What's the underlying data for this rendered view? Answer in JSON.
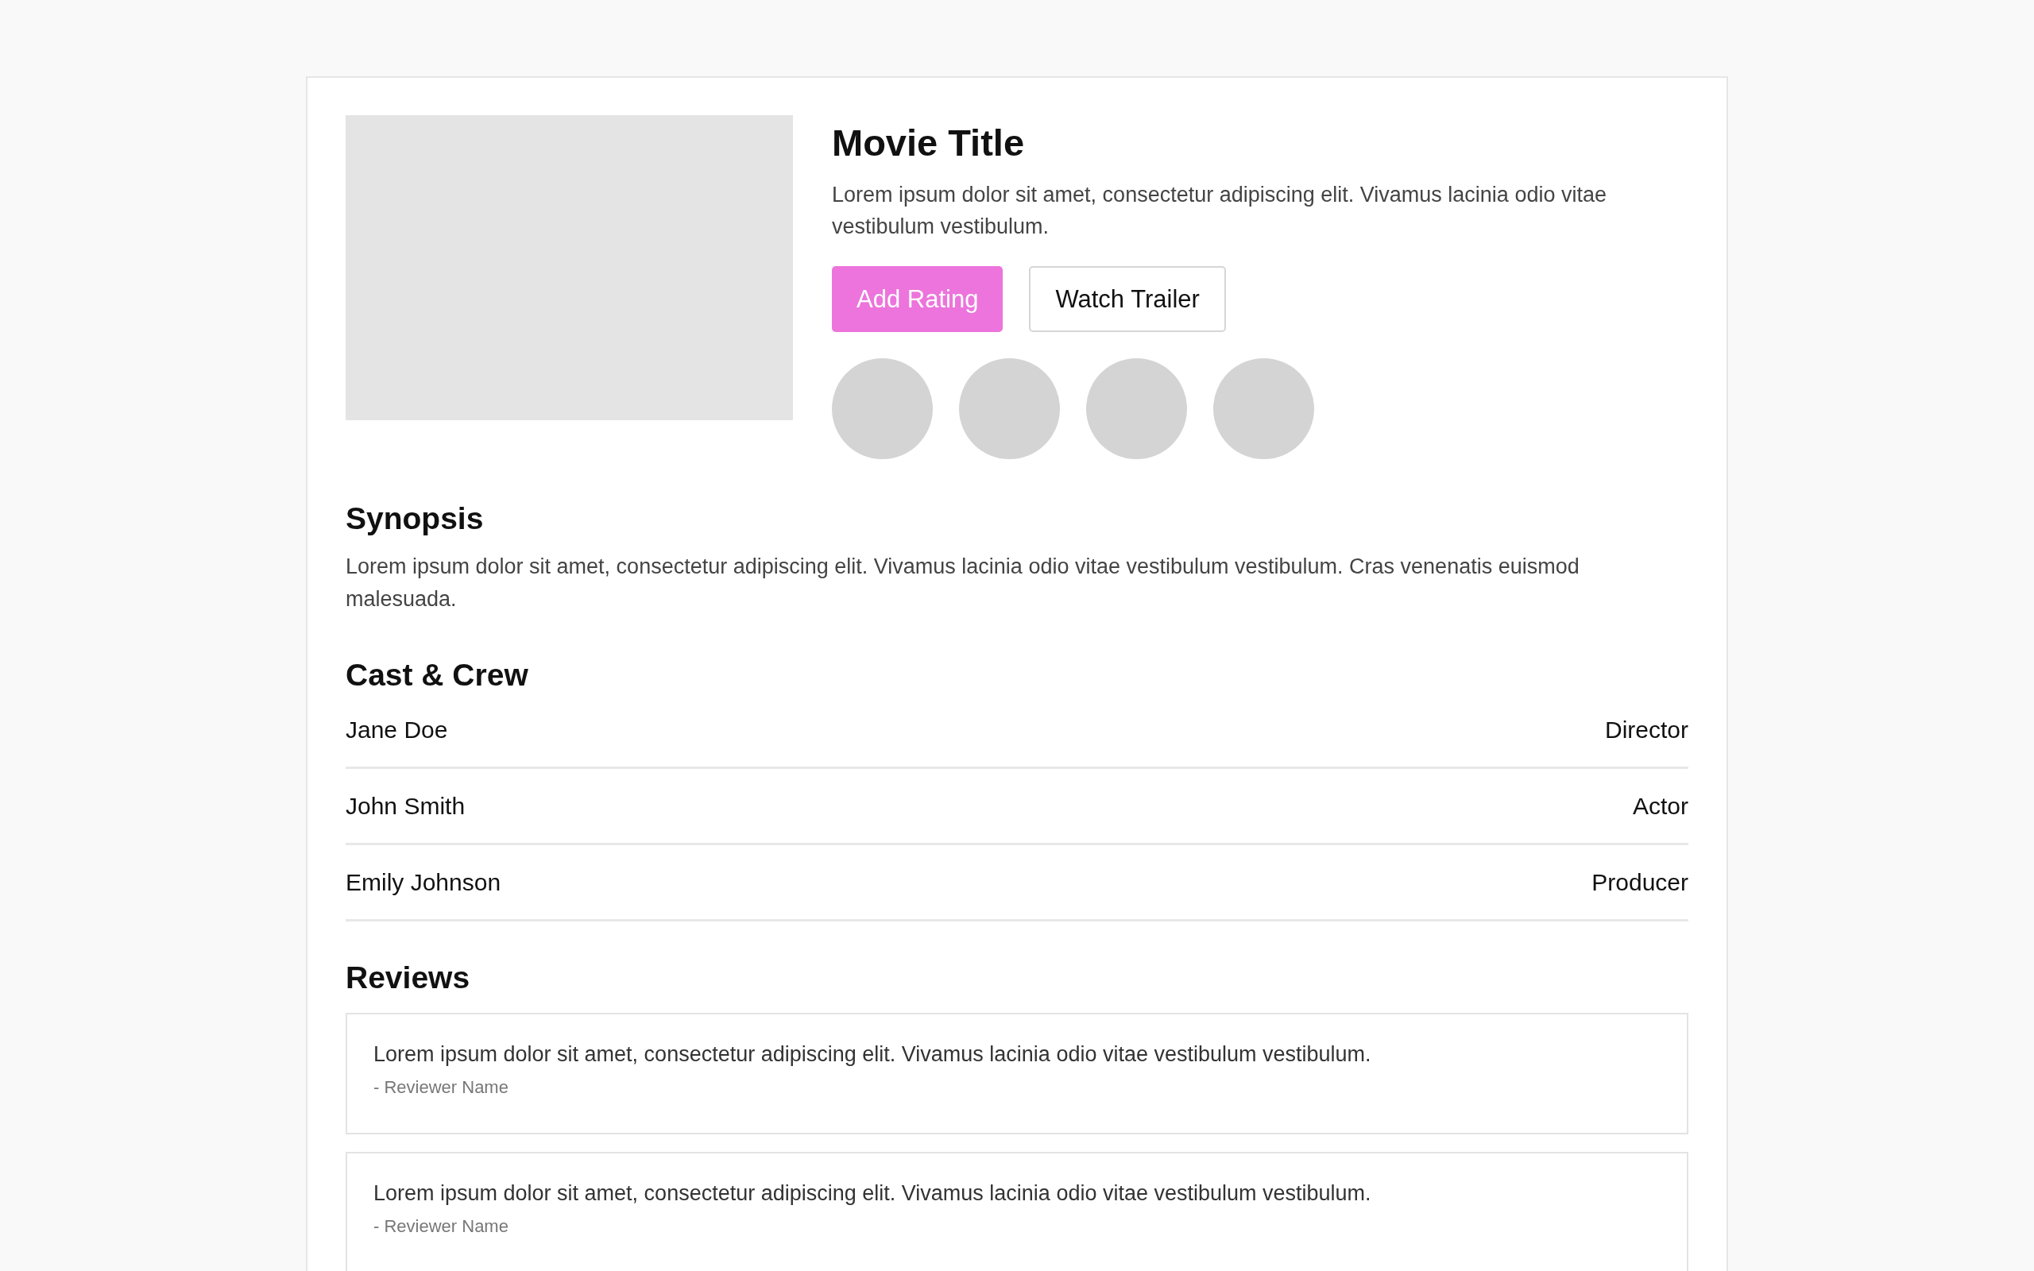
{
  "movie": {
    "title": "Movie Title",
    "description": "Lorem ipsum dolor sit amet, consectetur adipiscing elit. Vivamus lacinia odio vitae vestibulum vestibulum."
  },
  "buttons": [
    {
      "label": "Add Rating",
      "kind": "primary"
    },
    {
      "label": "Watch Trailer",
      "kind": "secondary"
    }
  ],
  "avatars": [
    {
      "kind": "placeholder"
    },
    {
      "kind": "placeholder"
    },
    {
      "kind": "placeholder"
    },
    {
      "kind": "placeholder"
    }
  ],
  "synopsis": {
    "heading": "Synopsis",
    "text": "Lorem ipsum dolor sit amet, consectetur adipiscing elit. Vivamus lacinia odio vitae vestibulum vestibulum. Cras venenatis euismod malesuada."
  },
  "cast": {
    "heading": "Cast & Crew",
    "members": [
      {
        "name": "Jane Doe",
        "role": "Director"
      },
      {
        "name": "John Smith",
        "role": "Actor"
      },
      {
        "name": "Emily Johnson",
        "role": "Producer"
      }
    ]
  },
  "reviews": {
    "heading": "Reviews",
    "items": [
      {
        "text": "Lorem ipsum dolor sit amet, consectetur adipiscing elit. Vivamus lacinia odio vitae vestibulum vestibulum.",
        "author": "- Reviewer Name"
      },
      {
        "text": "Lorem ipsum dolor sit amet, consectetur adipiscing elit. Vivamus lacinia odio vitae vestibulum vestibulum.",
        "author": "- Reviewer Name"
      }
    ]
  }
}
